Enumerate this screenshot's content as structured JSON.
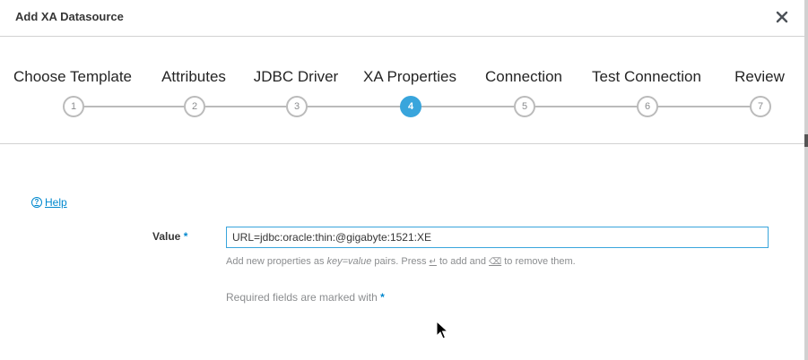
{
  "dialog": {
    "title": "Add XA Datasource",
    "close_glyph": "✕"
  },
  "wizard": {
    "steps": [
      {
        "label": "Choose Template",
        "number": "1",
        "active": false
      },
      {
        "label": "Attributes",
        "number": "2",
        "active": false
      },
      {
        "label": "JDBC Driver",
        "number": "3",
        "active": false
      },
      {
        "label": "XA Properties",
        "number": "4",
        "active": true
      },
      {
        "label": "Connection",
        "number": "5",
        "active": false
      },
      {
        "label": "Test Connection",
        "number": "6",
        "active": false
      },
      {
        "label": "Review",
        "number": "7",
        "active": false
      }
    ]
  },
  "help": {
    "icon": "question-circle-icon",
    "label": "Help"
  },
  "form": {
    "value_label": "Value",
    "required_marker": "*",
    "value": "URL=jdbc:oracle:thin:@gigabyte:1521:XE",
    "help_pre": "Add new properties as ",
    "help_kv": "key=value",
    "help_mid": " pairs. Press ",
    "enter_glyph": "↵",
    "help_mid2": " to add and ",
    "backspace_glyph": "⌫",
    "help_post": " to remove them.",
    "required_note": "Required fields are marked with"
  },
  "colors": {
    "accent": "#39a5dc",
    "link": "#0088ce",
    "border": "#d1d1d1"
  }
}
